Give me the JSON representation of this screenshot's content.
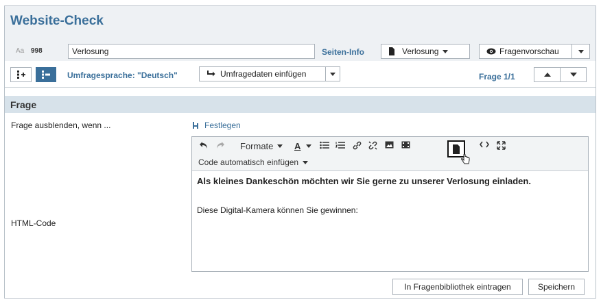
{
  "app": {
    "title": "Website-Check"
  },
  "page_id_row": {
    "aa_label": "Aa",
    "number": "998",
    "name_value": "Verlosung"
  },
  "header": {
    "seiten_info": "Seiten-Info",
    "page_select": "Verlosung",
    "preview_button": "Fragenvorschau"
  },
  "toolbar2": {
    "language_label": "Umfragesprache: \"Deutsch\"",
    "insert_button": "Umfragedaten einfügen",
    "frage_counter": "Frage 1/1"
  },
  "section": {
    "title": "Frage"
  },
  "rows": {
    "hide_label": "Frage ausblenden, wenn ...",
    "hide_link": "Festlegen",
    "html_label": "HTML-Code"
  },
  "editor": {
    "formats_label": "Formate",
    "code_insert_label": "Code automatisch einfügen",
    "content_bold": "Als kleines Dankeschön möchten wir Sie gerne zu unserer Verlosung einladen.",
    "content_text": "Diese Digital-Kamera können Sie gewinnen:"
  },
  "footer": {
    "library_button": "In Fragenbibliothek eintragen",
    "save_button": "Speichern"
  },
  "colors": {
    "accent": "#3a6f9a",
    "section_bg": "#d7e2ea",
    "header_bg": "#eef1f4"
  }
}
